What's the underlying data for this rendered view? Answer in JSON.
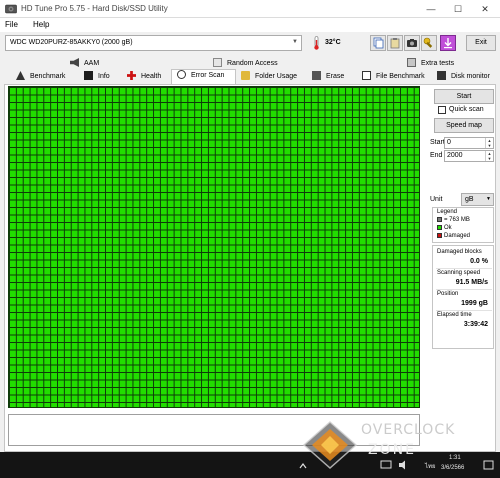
{
  "window": {
    "title": "HD Tune Pro 5.75 - Hard Disk/SSD Utility",
    "minimize": "—",
    "maximize": "☐",
    "close": "✕"
  },
  "menu": [
    "File",
    "Help"
  ],
  "toolbar": {
    "drive": "WDC WD20PURZ-85AKKY0 (2000 gB)",
    "temperature": "32°C",
    "exit_label": "Exit"
  },
  "tabs_top": [
    "AAM",
    "Random Access",
    "Extra tests"
  ],
  "tabs_bottom": [
    "Benchmark",
    "Info",
    "Health",
    "Error Scan",
    "Folder Usage",
    "Erase",
    "File Benchmark",
    "Disk monitor"
  ],
  "active_tab": "Error Scan",
  "controls": {
    "start_label": "Start",
    "quick_scan_label": "Quick scan",
    "quick_scan_checked": false,
    "speed_map_label": "Speed map",
    "start_field_label": "Start",
    "start_value": "0",
    "end_field_label": "End",
    "end_value": "2000",
    "unit_label": "Unit",
    "unit_value": "gB"
  },
  "legend": {
    "title": "Legend",
    "items": [
      {
        "label": "= 763 MB",
        "color": "#7a7a7a"
      },
      {
        "label": "Ok",
        "color": "#22dd00"
      },
      {
        "label": "Damaged",
        "color": "#cc1111"
      }
    ]
  },
  "stats": {
    "damaged_label": "Damaged blocks",
    "damaged_value": "0.0 %",
    "speed_label": "Scanning speed",
    "speed_value": "91.5 MB/s",
    "position_label": "Position",
    "position_value": "1999 gB",
    "elapsed_label": "Elapsed time",
    "elapsed_value": "3:39:42"
  },
  "scan": {
    "ok_fraction": 1.0,
    "ok_color": "#22dd00",
    "gridline_color": "#0f3a0a"
  },
  "taskbar": {
    "time": "1:31",
    "date": "3/6/2566",
    "lang": "ไทย"
  },
  "watermark": {
    "line1": "OVERCLOCK",
    "line2": "ZONE"
  }
}
